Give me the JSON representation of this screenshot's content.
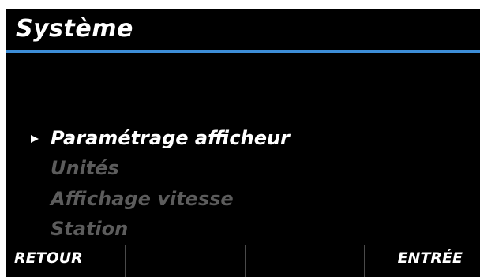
{
  "header": {
    "title": "Système"
  },
  "menu": {
    "items": [
      {
        "label": "Paramétrage afficheur",
        "selected": true
      },
      {
        "label": "Unités",
        "selected": false
      },
      {
        "label": "Affichage vitesse",
        "selected": false
      },
      {
        "label": "Station",
        "selected": false
      }
    ],
    "selection_marker_icon": "triangle-right-icon"
  },
  "softkeys": {
    "left_label": "RETOUR",
    "mid1_label": "",
    "mid2_label": "",
    "right_label": "ENTRÉE"
  },
  "colors": {
    "background": "#000000",
    "accent": "#3d8ed8",
    "selected_text": "#ffffff",
    "unselected_text": "#5c5c5c",
    "divider": "#4a4a4a"
  }
}
